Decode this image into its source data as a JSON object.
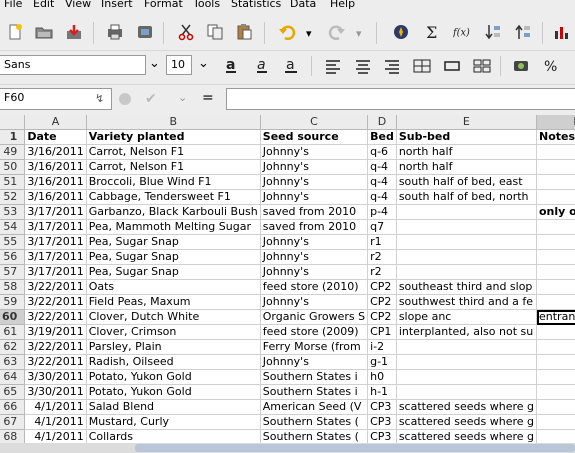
{
  "menu": [
    "File",
    "Edit",
    "View",
    "Insert",
    "Format",
    "Tools",
    "Statistics",
    "Data",
    "Help"
  ],
  "font": {
    "name": "Sans",
    "size": "10"
  },
  "namebox": "F60",
  "formula_label": "=",
  "formula_value": "",
  "columns": [
    "A",
    "B",
    "C",
    "D",
    "E",
    "F"
  ],
  "active_column": "F",
  "header_row": {
    "num": "1",
    "cells": [
      "Date",
      "Variety planted",
      "Seed source",
      "Bed",
      "Sub-bed",
      "Notes"
    ]
  },
  "rows": [
    {
      "num": "49",
      "cells": [
        "3/16/2011",
        "Carrot, Nelson F1",
        "Johnny's",
        "q-6",
        "north half",
        ""
      ]
    },
    {
      "num": "50",
      "cells": [
        "3/16/2011",
        "Carrot, Nelson F1",
        "Johnny's",
        "q-4",
        "north half",
        ""
      ]
    },
    {
      "num": "51",
      "cells": [
        "3/16/2011",
        "Broccoli, Blue Wind F1",
        "Johnny's",
        "q-4",
        "south  half of bed, east",
        ""
      ]
    },
    {
      "num": "52",
      "cells": [
        "3/16/2011",
        "Cabbage, Tendersweet F1",
        "Johnny's",
        "q-4",
        "south half of bed, north",
        ""
      ]
    },
    {
      "num": "53",
      "cells": [
        "3/17/2011",
        "Garbanzo, Black Karbouli Bush",
        "saved from 2010",
        "p-4",
        "",
        "only one car"
      ]
    },
    {
      "num": "54",
      "cells": [
        "3/17/2011",
        "Pea, Mammoth Melting Sugar",
        "saved from 2010",
        "q7",
        "",
        ""
      ]
    },
    {
      "num": "55",
      "cells": [
        "3/17/2011",
        "Pea, Sugar Snap",
        "Johnny's",
        "r1",
        "",
        ""
      ]
    },
    {
      "num": "56",
      "cells": [
        "3/17/2011",
        "Pea, Sugar Snap",
        "Johnny's",
        "r2",
        "",
        ""
      ]
    },
    {
      "num": "57",
      "cells": [
        "3/17/2011",
        "Pea, Sugar Snap",
        "Johnny's",
        "r2",
        "",
        ""
      ]
    },
    {
      "num": "58",
      "cells": [
        "3/22/2011",
        "Oats",
        "feed store (2010)",
        "CP2",
        "southeast third and slop",
        ""
      ]
    },
    {
      "num": "59",
      "cells": [
        "3/22/2011",
        "Field Peas, Maxum",
        "Johnny's",
        "CP2",
        "southwest third and a fe",
        ""
      ]
    },
    {
      "num": "60",
      "cells": [
        "3/22/2011",
        "Clover, Dutch White",
        "Organic Growers S",
        "CP2",
        "slope anc",
        "entrance"
      ]
    },
    {
      "num": "61",
      "cells": [
        "3/19/2011",
        "Clover, Crimson",
        "feed store (2009)",
        "CP1",
        "interplanted, also not su",
        ""
      ]
    },
    {
      "num": "62",
      "cells": [
        "3/22/2011",
        "Parsley, Plain",
        "Ferry Morse (from",
        "i-2",
        "",
        ""
      ]
    },
    {
      "num": "63",
      "cells": [
        "3/22/2011",
        "Radish, Oilseed",
        "Johnny's",
        "g-1",
        "",
        ""
      ]
    },
    {
      "num": "64",
      "cells": [
        "3/30/2011",
        "Potato, Yukon Gold",
        "Southern States i",
        "h0",
        "",
        ""
      ]
    },
    {
      "num": "65",
      "cells": [
        "3/30/2011",
        "Potato, Yukon Gold",
        "Southern States i",
        "h-1",
        "",
        ""
      ]
    },
    {
      "num": "66",
      "cells": [
        "4/1/2011",
        "Salad Blend",
        "American Seed (V",
        "CP3",
        "scattered seeds where g",
        ""
      ]
    },
    {
      "num": "67",
      "cells": [
        "4/1/2011",
        "Mustard, Curly",
        "Southern States (",
        "CP3",
        "scattered seeds where g",
        ""
      ]
    },
    {
      "num": "68",
      "cells": [
        "4/1/2011",
        "Collards",
        "Southern States (",
        "CP3",
        "scattered seeds where g",
        ""
      ]
    }
  ],
  "active_row": "60",
  "icons": {
    "toolbar1": [
      "new-document-icon",
      "open-folder-icon",
      "save-icon",
      "print-icon",
      "print-preview-icon",
      "cut-icon",
      "copy-icon",
      "paste-icon",
      "undo-icon",
      "redo-icon",
      "navigator-icon",
      "sum-icon",
      "function-icon",
      "sort-descending-icon",
      "sort-ascending-icon",
      "chart-icon"
    ],
    "toolbar2": [
      "bold-icon",
      "italic-icon",
      "underline-icon",
      "align-left-icon",
      "align-center-icon",
      "align-right-icon",
      "merge-cells-icon",
      "split-cells-icon",
      "insert-cells-icon",
      "currency-icon",
      "percent-icon"
    ]
  },
  "colors": {
    "accent": "#b8c6d8",
    "selection_header": "#cfcfcf"
  }
}
